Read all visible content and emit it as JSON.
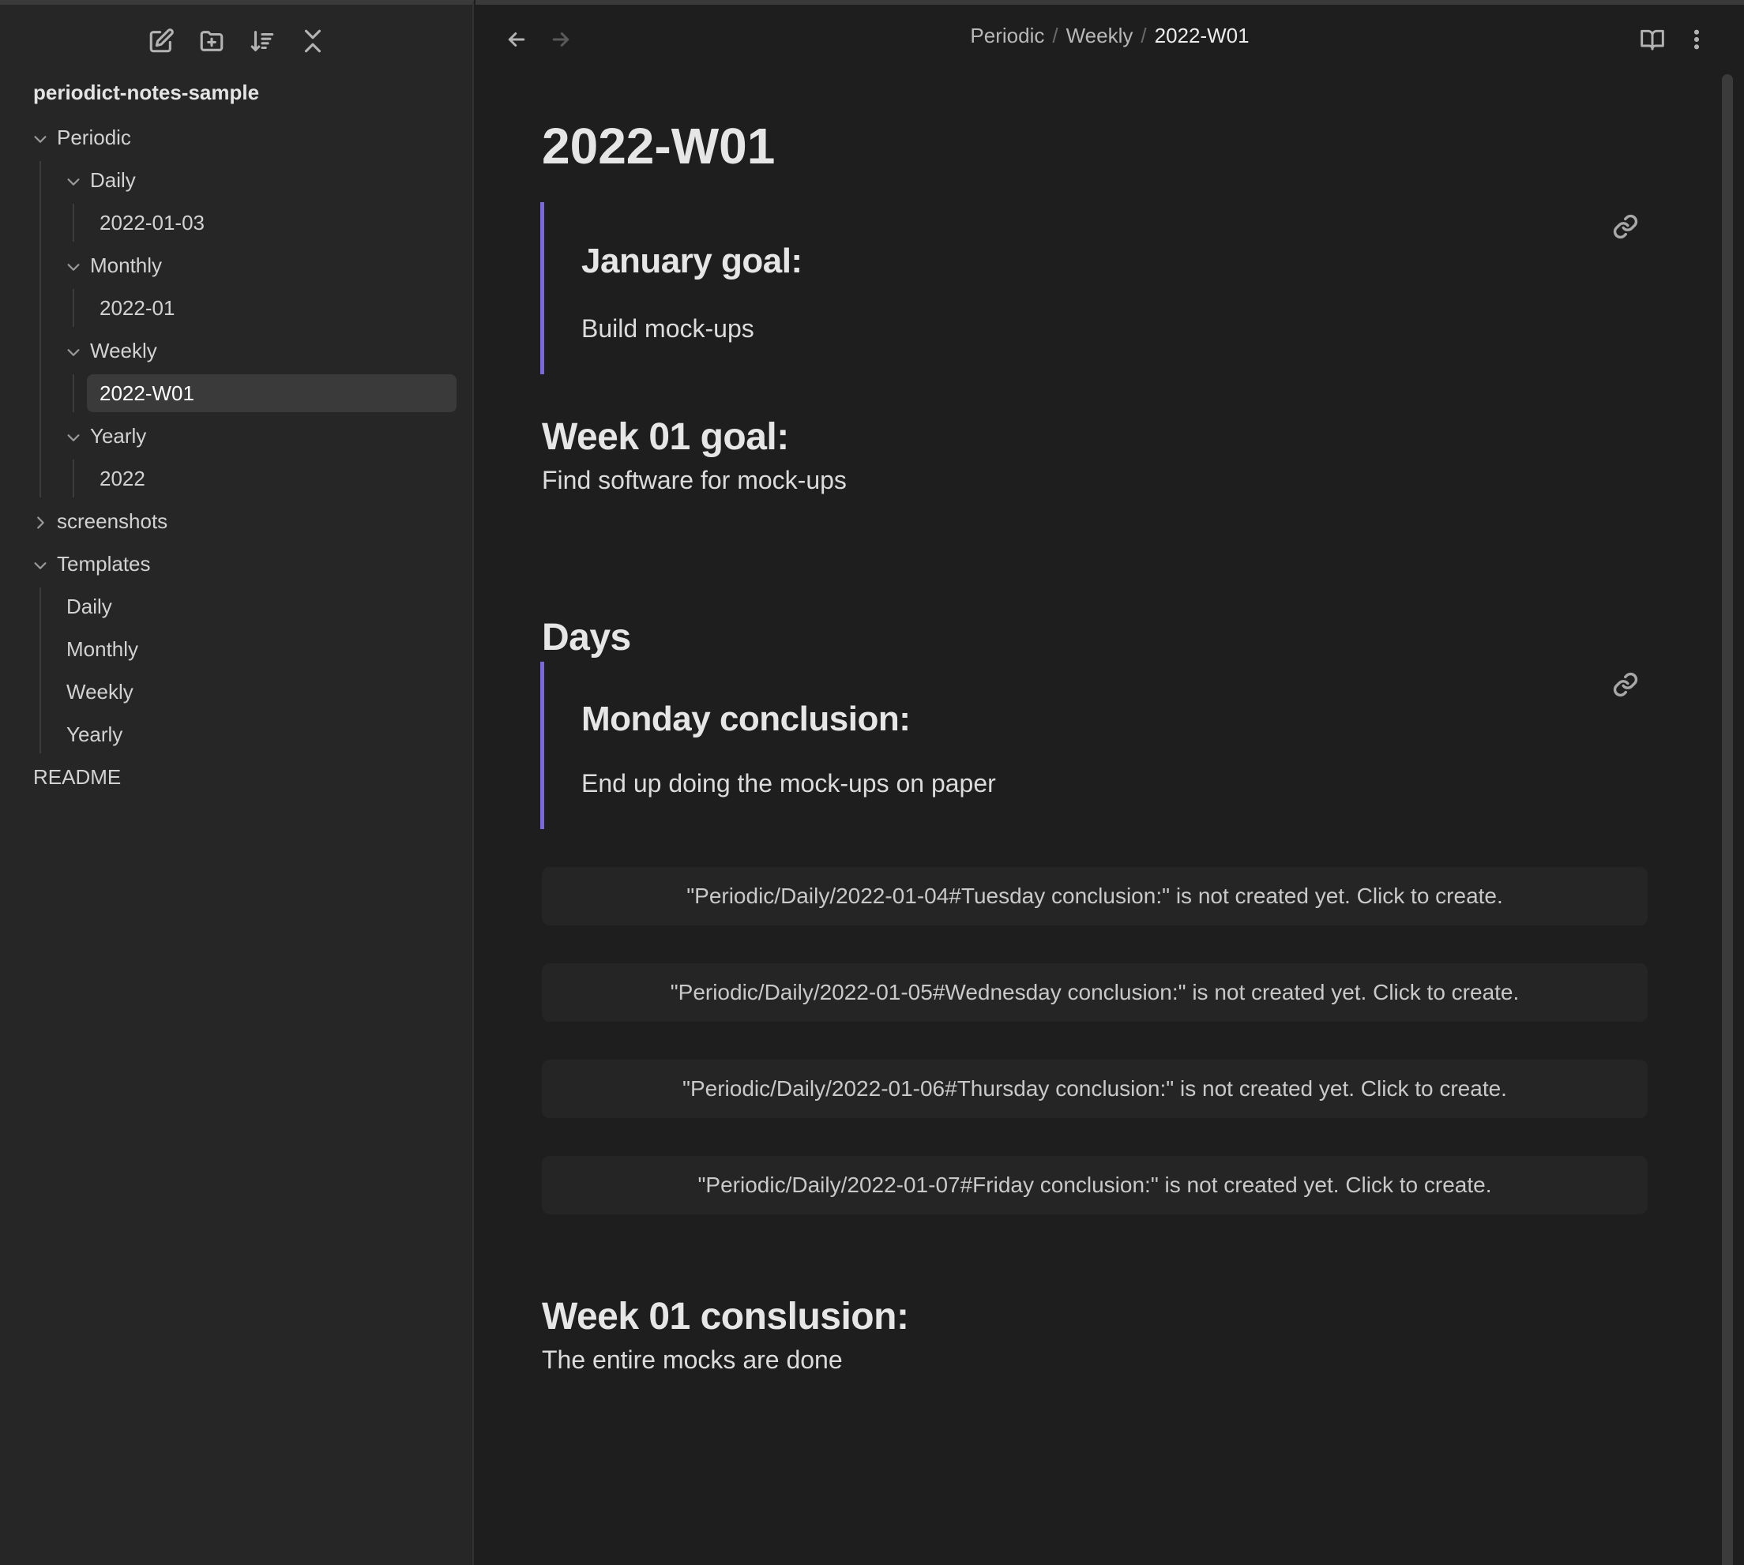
{
  "sidebar": {
    "vault_name": "periodict-notes-sample",
    "toolbar": [
      "new-note",
      "new-folder",
      "sort",
      "collapse-all"
    ],
    "tree": {
      "periodic": "Periodic",
      "daily": "Daily",
      "daily_note": "2022-01-03",
      "monthly": "Monthly",
      "monthly_note": "2022-01",
      "weekly": "Weekly",
      "weekly_note": "2022-W01",
      "yearly": "Yearly",
      "yearly_note": "2022",
      "screenshots": "screenshots",
      "templates": "Templates",
      "tpl_daily": "Daily",
      "tpl_monthly": "Monthly",
      "tpl_weekly": "Weekly",
      "tpl_yearly": "Yearly",
      "readme": "README"
    }
  },
  "header": {
    "breadcrumb": [
      "Periodic",
      "Weekly",
      "2022-W01"
    ]
  },
  "note": {
    "title": "2022-W01",
    "embed1": {
      "heading": "January goal:",
      "body": "Build mock-ups"
    },
    "week_goal_heading": "Week 01 goal:",
    "week_goal_body": "Find software for mock-ups",
    "days_heading": "Days",
    "embed2": {
      "heading": "Monday conclusion:",
      "body": "End up doing the mock-ups on paper"
    },
    "missing": [
      "\"Periodic/Daily/2022-01-04#Tuesday conclusion:\" is not created yet. Click to create.",
      "\"Periodic/Daily/2022-01-05#Wednesday conclusion:\" is not created yet. Click to create.",
      "\"Periodic/Daily/2022-01-06#Thursday conclusion:\" is not created yet. Click to create.",
      "\"Periodic/Daily/2022-01-07#Friday conclusion:\" is not created yet. Click to create."
    ],
    "conclusion_heading": "Week 01 conslusion:",
    "conclusion_body": "The entire mocks are done"
  },
  "colors": {
    "accent": "#7b68d9",
    "background": "#1e1e1e",
    "sidebar": "#262626"
  }
}
